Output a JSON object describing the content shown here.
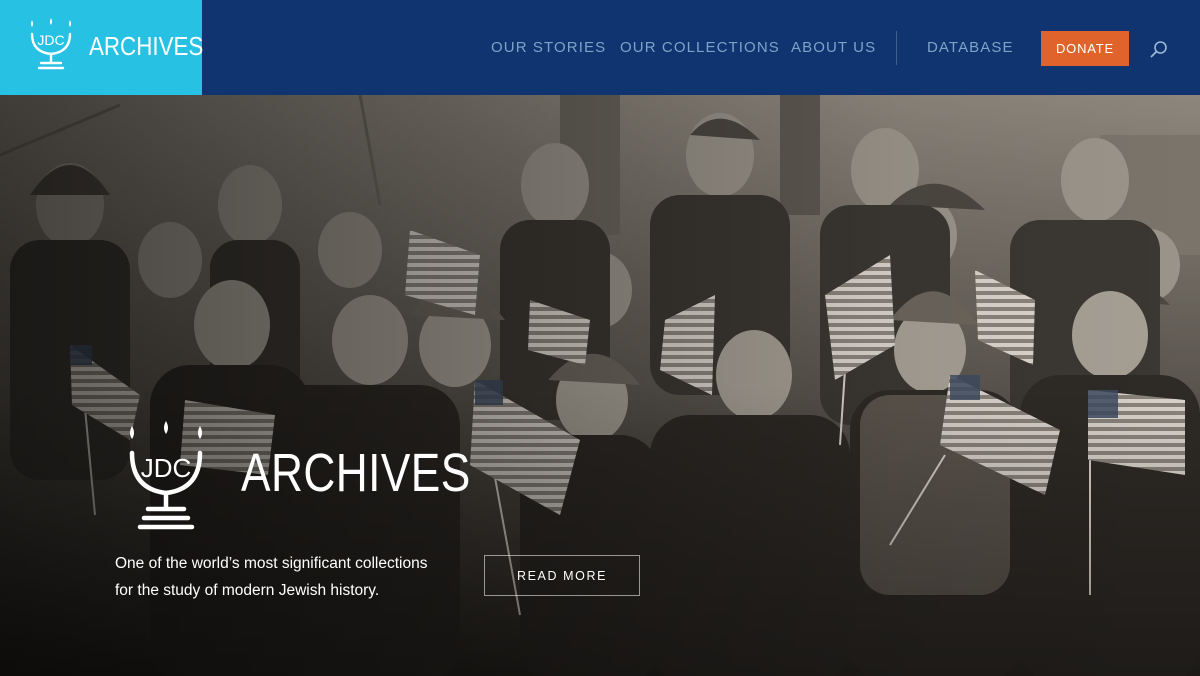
{
  "brand": {
    "logo_text": "JDC",
    "name": "ARCHIVES",
    "logo_bg": "#27c1e4",
    "header_bg": "#0f3470"
  },
  "nav": {
    "items": [
      {
        "label": "OUR STORIES"
      },
      {
        "label": "OUR COLLECTIONS"
      },
      {
        "label": "ABOUT US"
      },
      {
        "label": "DATABASE"
      }
    ],
    "donate_label": "DONATE",
    "donate_color": "#e0632c",
    "search_icon": "search-icon"
  },
  "hero": {
    "logo_text": "JDC",
    "title": "ARCHIVES",
    "tagline_line1": "One of the world’s most significant collections",
    "tagline_line2": "for the study of modern Jewish history.",
    "cta_label": "READ MORE",
    "image": "black-and-white photo of children holding American flags"
  }
}
